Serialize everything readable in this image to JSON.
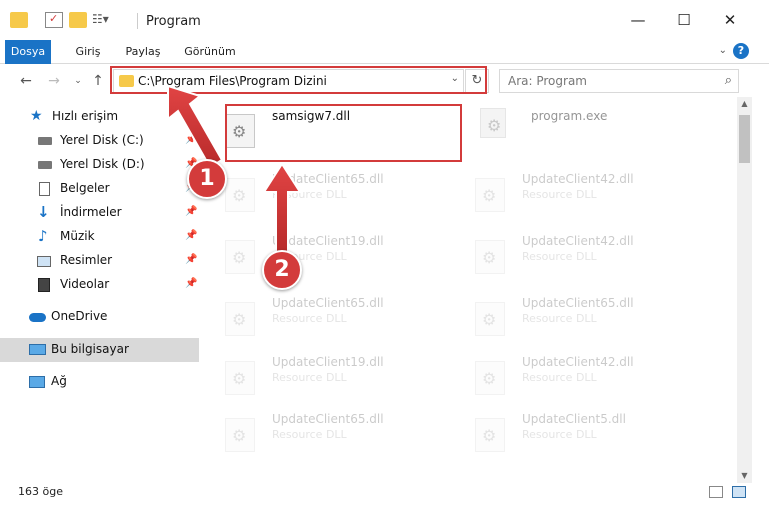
{
  "window": {
    "title": "Program",
    "minimize": "—",
    "maximize": "☐",
    "close": "✕"
  },
  "ribbon": {
    "tabs": [
      "Dosya",
      "Giriş",
      "Paylaş",
      "Görünüm"
    ],
    "help": "?"
  },
  "nav": {
    "address": "C:\\Program Files\\Program Dizini",
    "search_placeholder": "Ara: Program"
  },
  "sidebar": {
    "items": [
      {
        "label": "Hızlı erişim",
        "icon": "star-icon"
      },
      {
        "label": "Yerel Disk (C:)",
        "icon": "drive-icon"
      },
      {
        "label": "Yerel Disk (D:)",
        "icon": "drive-icon"
      },
      {
        "label": "Belgeler",
        "icon": "document-icon"
      },
      {
        "label": "İndirmeler",
        "icon": "download-icon"
      },
      {
        "label": "Müzik",
        "icon": "music-icon"
      },
      {
        "label": "Resimler",
        "icon": "picture-icon"
      },
      {
        "label": "Videolar",
        "icon": "video-icon"
      },
      {
        "label": "OneDrive",
        "icon": "cloud-icon"
      },
      {
        "label": "Bu bilgisayar",
        "icon": "computer-icon"
      },
      {
        "label": "Ağ",
        "icon": "network-icon"
      }
    ]
  },
  "files": {
    "highlighted": {
      "name": "samsigw7.dll"
    },
    "program": {
      "name": "program.exe"
    },
    "items": [
      {
        "name": "UpdateClient65.dll",
        "type": "Resource DLL"
      },
      {
        "name": "UpdateClient42.dll",
        "type": "Resource DLL"
      },
      {
        "name": "UpdateClient19.dll",
        "type": "Resource DLL"
      },
      {
        "name": "UpdateClient42.dll",
        "type": "Resource DLL"
      },
      {
        "name": "UpdateClient65.dll",
        "type": "Resource DLL"
      },
      {
        "name": "UpdateClient65.dll",
        "type": "Resource DLL"
      },
      {
        "name": "UpdateClient19.dll",
        "type": "Resource DLL"
      },
      {
        "name": "UpdateClient42.dll",
        "type": "Resource DLL"
      },
      {
        "name": "UpdateClient65.dll",
        "type": "Resource DLL"
      },
      {
        "name": "UpdateClient5.dll",
        "type": "Resource DLL"
      }
    ]
  },
  "status": {
    "count": "163 öge"
  },
  "annotations": {
    "step1": "1",
    "step2": "2"
  },
  "colors": {
    "accent": "#1a73c6",
    "highlight": "#d33b3b",
    "folder": "#f6c94a"
  }
}
